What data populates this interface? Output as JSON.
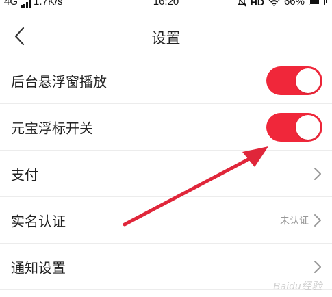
{
  "status_bar": {
    "network": "4G",
    "speed": "1.7K/s",
    "time": "16:20",
    "hd": "HD",
    "battery": "66%",
    "battery_level": 0.66,
    "icons": [
      "signal-icon",
      "mute-icon",
      "wifi-icon",
      "battery-icon"
    ]
  },
  "nav": {
    "title": "设置",
    "back_icon": "chevron-left-icon"
  },
  "rows": [
    {
      "label": "后台悬浮窗播放",
      "type": "toggle",
      "on": true
    },
    {
      "label": "元宝浮标开关",
      "type": "toggle",
      "on": true
    },
    {
      "label": "支付",
      "type": "link"
    },
    {
      "label": "实名认证",
      "type": "link",
      "status": "未认证"
    },
    {
      "label": "通知设置",
      "type": "link"
    }
  ],
  "colors": {
    "accent": "#f0273a",
    "annotation": "#e0263a"
  },
  "watermark": "Baidu经验"
}
